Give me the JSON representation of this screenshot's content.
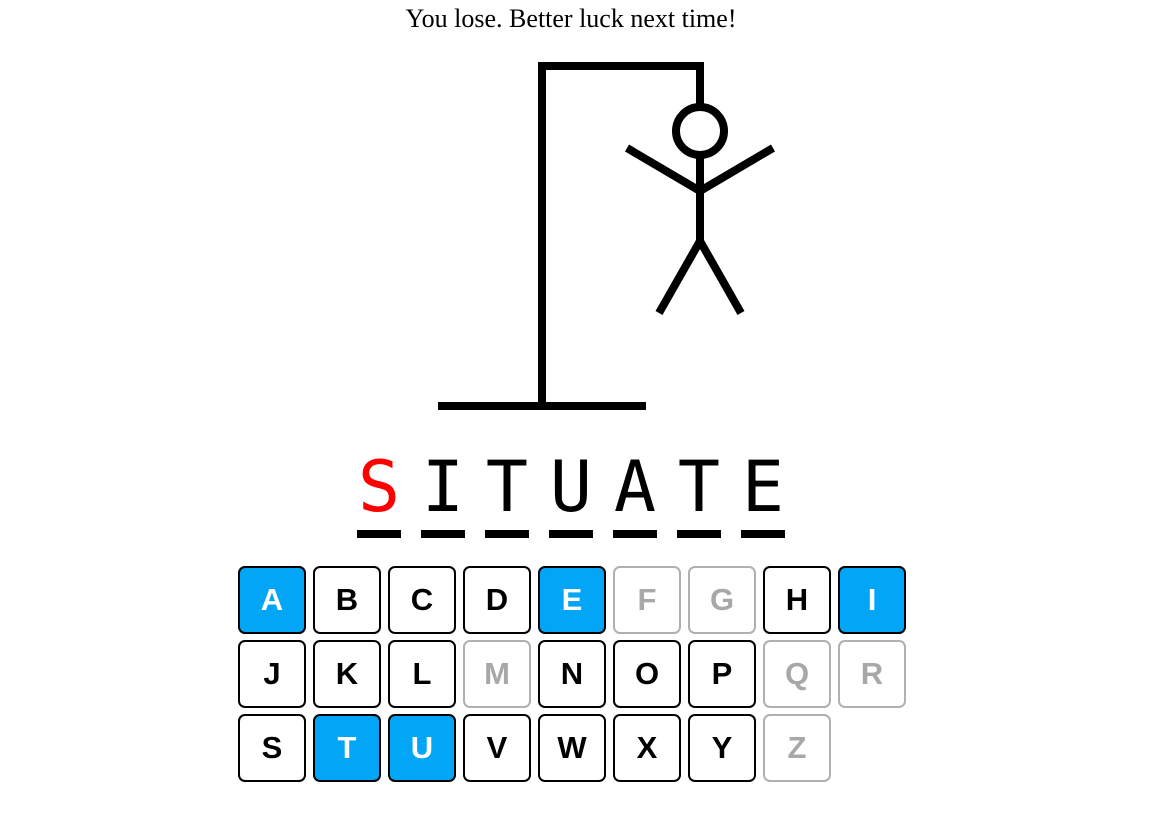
{
  "status_message": "You lose. Better luck next time!",
  "word": [
    {
      "char": "S",
      "state": "missed"
    },
    {
      "char": "I",
      "state": "revealed"
    },
    {
      "char": "T",
      "state": "revealed"
    },
    {
      "char": "U",
      "state": "revealed"
    },
    {
      "char": "A",
      "state": "revealed"
    },
    {
      "char": "T",
      "state": "revealed"
    },
    {
      "char": "E",
      "state": "revealed"
    }
  ],
  "keyboard": [
    {
      "letter": "A",
      "state": "correct"
    },
    {
      "letter": "B",
      "state": "available"
    },
    {
      "letter": "C",
      "state": "available"
    },
    {
      "letter": "D",
      "state": "available"
    },
    {
      "letter": "E",
      "state": "correct"
    },
    {
      "letter": "F",
      "state": "disabled"
    },
    {
      "letter": "G",
      "state": "disabled"
    },
    {
      "letter": "H",
      "state": "available"
    },
    {
      "letter": "I",
      "state": "correct"
    },
    {
      "letter": "J",
      "state": "available"
    },
    {
      "letter": "K",
      "state": "available"
    },
    {
      "letter": "L",
      "state": "available"
    },
    {
      "letter": "M",
      "state": "disabled"
    },
    {
      "letter": "N",
      "state": "available"
    },
    {
      "letter": "O",
      "state": "available"
    },
    {
      "letter": "P",
      "state": "available"
    },
    {
      "letter": "Q",
      "state": "disabled"
    },
    {
      "letter": "R",
      "state": "disabled"
    },
    {
      "letter": "S",
      "state": "available"
    },
    {
      "letter": "T",
      "state": "correct"
    },
    {
      "letter": "U",
      "state": "correct"
    },
    {
      "letter": "V",
      "state": "available"
    },
    {
      "letter": "W",
      "state": "available"
    },
    {
      "letter": "X",
      "state": "available"
    },
    {
      "letter": "Y",
      "state": "available"
    },
    {
      "letter": "Z",
      "state": "disabled"
    }
  ],
  "hangman": {
    "parts_shown": [
      "base",
      "pole",
      "beam",
      "rope",
      "head",
      "body",
      "left-arm",
      "right-arm",
      "left-leg",
      "right-leg"
    ]
  },
  "colors": {
    "correct_key": "#03a5f6",
    "missed_letter": "#ff0000",
    "disabled_key_text": "#a8a8a8"
  }
}
